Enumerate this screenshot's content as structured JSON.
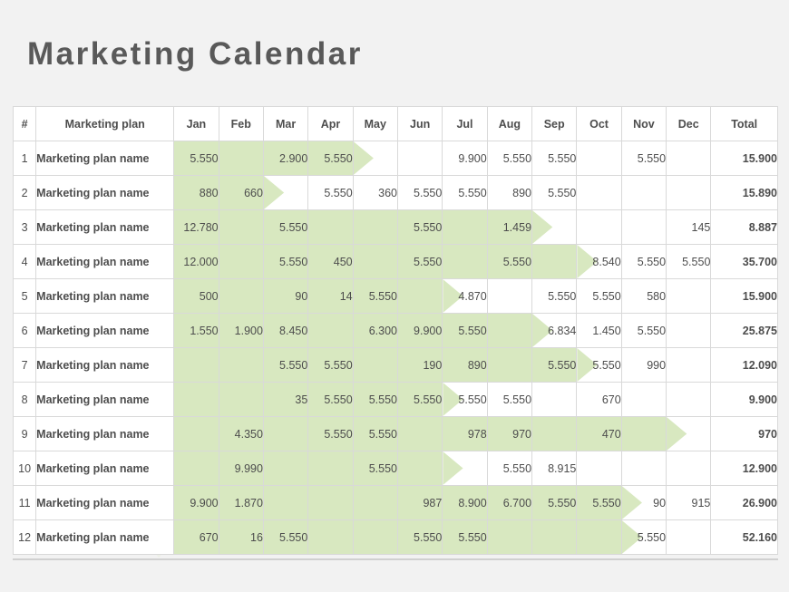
{
  "title": "Marketing Calendar",
  "colors": {
    "header_blue": "#35a8e0",
    "header_green": "#7dba42",
    "band_green": "#d8e8c0",
    "background": "#f2f2f2",
    "title_gray": "#595959"
  },
  "table": {
    "headers": {
      "index": "#",
      "plan": "Marketing plan",
      "months": [
        "Jan",
        "Feb",
        "Mar",
        "Apr",
        "May",
        "Jun",
        "Jul",
        "Aug",
        "Sep",
        "Oct",
        "Nov",
        "Dec"
      ],
      "total": "Total"
    },
    "rows": [
      {
        "index": "1",
        "plan": "Marketing plan name",
        "values": [
          "5.550",
          "",
          "2.900",
          "5.550",
          "",
          "",
          "9.900",
          "5.550",
          "5.550",
          "",
          "5.550",
          ""
        ],
        "band_start": 0,
        "band_end": 3,
        "tip": 4,
        "total": "15.900"
      },
      {
        "index": "2",
        "plan": "Marketing plan name",
        "values": [
          "880",
          "660",
          "",
          "5.550",
          "360",
          "5.550",
          "5.550",
          "890",
          "5.550",
          "",
          "",
          ""
        ],
        "band_start": 0,
        "band_end": 1,
        "tip": 2,
        "total": "15.890"
      },
      {
        "index": "3",
        "plan": "Marketing plan name",
        "values": [
          "12.780",
          "",
          "5.550",
          "",
          "",
          "5.550",
          "",
          "1.459",
          "",
          "",
          "",
          "145"
        ],
        "band_start": 0,
        "band_end": 7,
        "tip": 8,
        "total": "8.887"
      },
      {
        "index": "4",
        "plan": "Marketing plan name",
        "values": [
          "12.000",
          "",
          "5.550",
          "450",
          "",
          "5.550",
          "",
          "5.550",
          "",
          "8.540",
          "5.550",
          "5.550"
        ],
        "band_start": 0,
        "band_end": 8,
        "tip": 9,
        "total": "35.700"
      },
      {
        "index": "5",
        "plan": "Marketing plan name",
        "values": [
          "500",
          "",
          "90",
          "14",
          "5.550",
          "",
          "4.870",
          "",
          "5.550",
          "5.550",
          "580",
          ""
        ],
        "band_start": 0,
        "band_end": 5,
        "tip": 6,
        "total": "15.900"
      },
      {
        "index": "6",
        "plan": "Marketing plan name",
        "values": [
          "1.550",
          "1.900",
          "8.450",
          "",
          "6.300",
          "9.900",
          "5.550",
          "",
          "6.834",
          "1.450",
          "5.550",
          ""
        ],
        "band_start": 0,
        "band_end": 7,
        "tip": 8,
        "total": "25.875"
      },
      {
        "index": "7",
        "plan": "Marketing plan name",
        "values": [
          "",
          "",
          "5.550",
          "5.550",
          "",
          "190",
          "890",
          "",
          "5.550",
          "5.550",
          "990",
          ""
        ],
        "band_start": 0,
        "band_end": 8,
        "tip": 9,
        "total": "12.090"
      },
      {
        "index": "8",
        "plan": "Marketing plan name",
        "values": [
          "",
          "",
          "35",
          "5.550",
          "5.550",
          "5.550",
          "5.550",
          "5.550",
          "",
          "670",
          "",
          ""
        ],
        "band_start": 0,
        "band_end": 5,
        "tip": 6,
        "total": "9.900"
      },
      {
        "index": "9",
        "plan": "Marketing plan name",
        "values": [
          "",
          "4.350",
          "",
          "5.550",
          "5.550",
          "",
          "978",
          "970",
          "",
          "470",
          "",
          ""
        ],
        "band_start": 0,
        "band_end": 10,
        "tip": 11,
        "total": "970"
      },
      {
        "index": "10",
        "plan": "Marketing plan name",
        "values": [
          "",
          "9.990",
          "",
          "",
          "5.550",
          "",
          "",
          "5.550",
          "8.915",
          "",
          "",
          ""
        ],
        "band_start": 0,
        "band_end": 5,
        "tip": 6,
        "total": "12.900"
      },
      {
        "index": "11",
        "plan": "Marketing plan name",
        "values": [
          "9.900",
          "1.870",
          "",
          "",
          "",
          "987",
          "8.900",
          "6.700",
          "5.550",
          "5.550",
          "90",
          "915"
        ],
        "band_start": 0,
        "band_end": 9,
        "tip": 10,
        "total": "26.900"
      },
      {
        "index": "12",
        "plan": "Marketing plan name",
        "values": [
          "670",
          "16",
          "5.550",
          "",
          "",
          "5.550",
          "5.550",
          "",
          "",
          "",
          "5.550",
          ""
        ],
        "band_start": 0,
        "band_end": 9,
        "tip": 10,
        "total": "52.160"
      }
    ]
  }
}
